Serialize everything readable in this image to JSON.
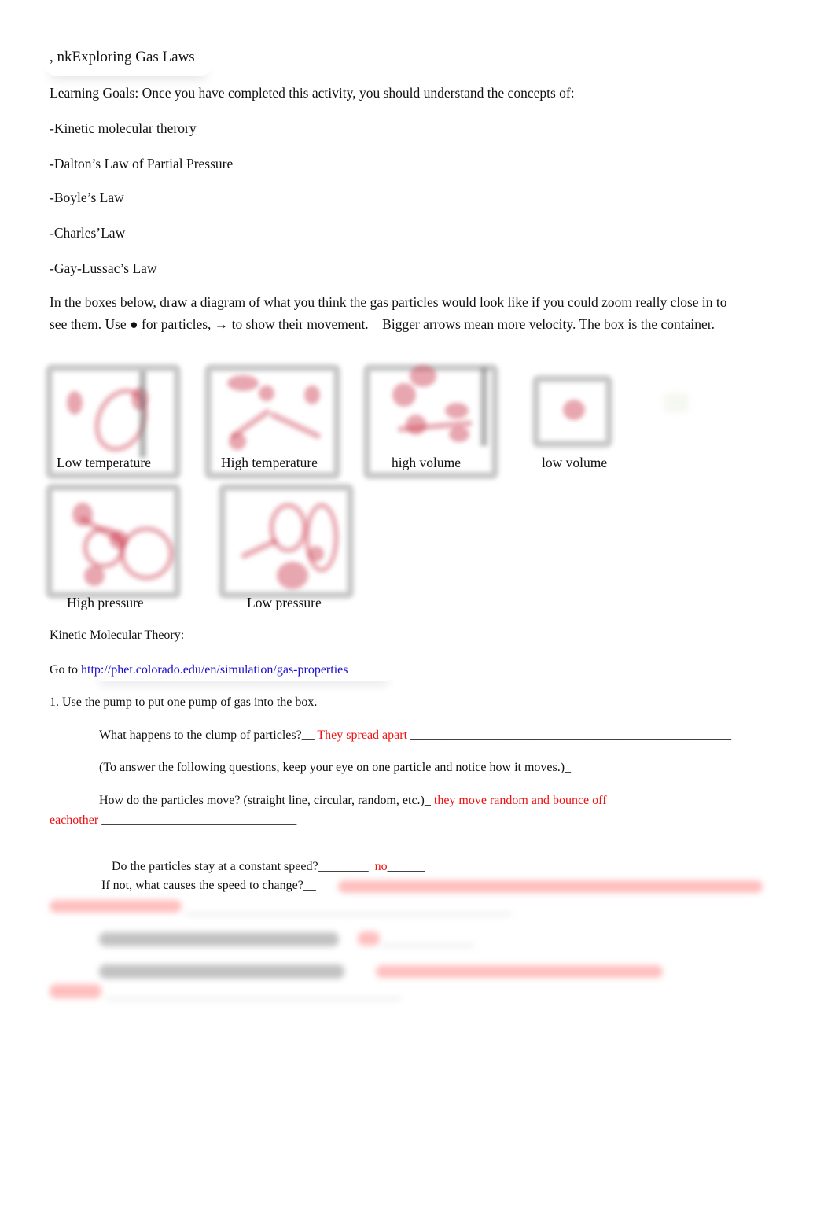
{
  "document": {
    "title": ", nkExploring Gas Laws",
    "learning_goals_label": "Learning Goals:",
    "learning_goals_text": "Once you have completed this activity, you should understand the concepts of:",
    "goals": [
      "-Kinetic molecular therory",
      "-Dalton’s Law of Partial Pressure",
      "-Boyle’s Law",
      "-Charles’Law",
      "-Gay-Lussac’s Law"
    ],
    "instructions_line1": "In the boxes below, draw a diagram of what you think the gas particles would look like if you could zoom really close in to",
    "instructions_line2": "see them. Use ● for particles, → to show their movement.    Bigger arrows mean more velocity. The box is the container.",
    "diagrams": [
      {
        "label": "Low temperature"
      },
      {
        "label": "High temperature"
      },
      {
        "label": "high volume"
      },
      {
        "label": "low volume"
      },
      {
        "label": "High pressure"
      },
      {
        "label": "Low pressure"
      }
    ],
    "section_heading": "Kinetic Molecular Theory:",
    "goto_prefix": "Go to ",
    "goto_link": "http://phet.colorado.edu/en/simulation/gas-properties",
    "step1": "1. Use the pump to put one pump of gas into the box.",
    "questions": {
      "q1_prompt": "What happens to the clump of particles?__ ",
      "q1_answer": "They spread apart",
      "q1_tail": " ___________________________________________________",
      "note": "(To answer the following questions, keep your eye on one particle and notice how it moves.)_",
      "q2_prompt": "How do the particles move? (straight line, circular, random, etc.)_ ",
      "q2_answer_line1": "they move random and bounce off",
      "q2_answer_line2": "eachother",
      "q2_tail": " _______________________________",
      "q3_prompt": "Do the particles stay at a constant speed?________  ",
      "q3_answer": "no",
      "q3_tail": "______",
      "q4_prompt": "If not, what causes the speed to change?__ "
    }
  },
  "colors": {
    "answer": "#ee1111",
    "link": "#1a0dcc",
    "text": "#111111"
  }
}
